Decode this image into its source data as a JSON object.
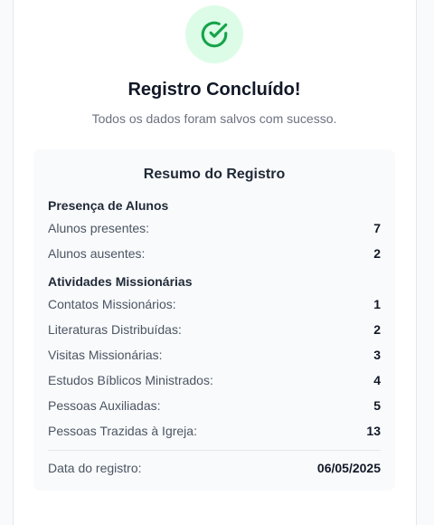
{
  "header": {
    "title": "Registro Concluído!",
    "subtitle": "Todos os dados foram salvos com sucesso."
  },
  "summary": {
    "title": "Resumo do Registro",
    "attendance": {
      "heading": "Presença de Alunos",
      "items": [
        {
          "label": "Alunos presentes:",
          "value": "7"
        },
        {
          "label": "Alunos ausentes:",
          "value": "2"
        }
      ]
    },
    "missionary": {
      "heading": "Atividades Missionárias",
      "items": [
        {
          "label": "Contatos Missionários:",
          "value": "1"
        },
        {
          "label": "Literaturas Distribuídas:",
          "value": "2"
        },
        {
          "label": "Visitas Missionárias:",
          "value": "3"
        },
        {
          "label": "Estudos Bíblicos Ministrados:",
          "value": "4"
        },
        {
          "label": "Pessoas Auxiliadas:",
          "value": "5"
        },
        {
          "label": "Pessoas Trazidas à Igreja:",
          "value": "13"
        }
      ]
    },
    "date": {
      "label": "Data do registro:",
      "value": "06/05/2025"
    }
  },
  "colors": {
    "success_bg": "#dcfce7",
    "success_icon": "#16a34a"
  },
  "icons": {
    "success": "check-circle-icon"
  }
}
